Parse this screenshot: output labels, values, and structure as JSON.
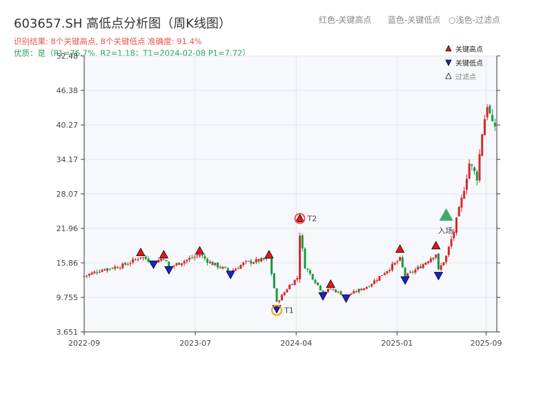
{
  "header": {
    "title": "603657.SH 高低点分析图（周K线图）",
    "hint_red": "红色-关键高点",
    "hint_blue": "蓝色-关键低点",
    "hint_filtered": "浅色-过滤点",
    "result_line": "识别结果: 8个关键高点, 8个关键低点  准确度: 91.4%",
    "quality_line": "优质：是（P1=76.7%, R2=1.18；T1=2024-02-08 P1=7.72）"
  },
  "legend": {
    "high": "关键高点",
    "low": "关键低点",
    "filtered": "过滤点"
  },
  "colors": {
    "up": "#d62728",
    "down": "#1a9641",
    "high_marker": "#e31a1c",
    "low_marker": "#1f1fd6",
    "t1": "#f0a500",
    "t2": "#e8554e",
    "entry": "#2ca05a",
    "result_text": "#e8554e",
    "quality_text": "#2ca05a"
  },
  "chart_data": {
    "type": "candlestick",
    "y_ticks": [
      "3.651",
      "9.755",
      "15.86",
      "21.96",
      "28.07",
      "34.17",
      "40.27",
      "46.38",
      "52.48"
    ],
    "ylim": [
      3.651,
      52.48
    ],
    "x_ticks": [
      "2022-09",
      "2023-07",
      "2024-04",
      "2025-01",
      "2025-09"
    ],
    "x_start": "2022-09-01",
    "x_end": "2025-09-30",
    "annotations": {
      "t1": {
        "label": "T1",
        "date": "2024-02-08",
        "value": 7.72
      },
      "t2": {
        "label": "T2",
        "date": "2024-04-11",
        "value": 23.6
      },
      "entry": {
        "label": "入场",
        "date": "2025-05-15",
        "value": 24.3
      }
    },
    "key_highs": [
      {
        "date": "2023-02-02",
        "value": 17.6
      },
      {
        "date": "2023-04-06",
        "value": 17.2
      },
      {
        "date": "2023-07-13",
        "value": 17.9
      },
      {
        "date": "2024-01-18",
        "value": 17.2
      },
      {
        "date": "2024-04-11",
        "value": 23.6
      },
      {
        "date": "2024-07-04",
        "value": 12.0
      },
      {
        "date": "2025-01-09",
        "value": 18.2
      },
      {
        "date": "2025-04-17",
        "value": 18.8
      }
    ],
    "key_lows": [
      {
        "date": "2023-03-09",
        "value": 15.6
      },
      {
        "date": "2023-04-20",
        "value": 14.6
      },
      {
        "date": "2023-10-05",
        "value": 13.8
      },
      {
        "date": "2024-02-08",
        "value": 7.72
      },
      {
        "date": "2024-06-13",
        "value": 10.0
      },
      {
        "date": "2024-08-15",
        "value": 9.6
      },
      {
        "date": "2025-01-23",
        "value": 12.8
      },
      {
        "date": "2025-04-24",
        "value": 13.6
      }
    ],
    "close_path": [
      [
        "2022-09-01",
        13.5
      ],
      [
        "2022-10-15",
        14.6
      ],
      [
        "2022-12-15",
        15.4
      ],
      [
        "2023-01-15",
        16.3
      ],
      [
        "2023-02-02",
        17.0
      ],
      [
        "2023-03-09",
        15.9
      ],
      [
        "2023-04-06",
        16.8
      ],
      [
        "2023-04-20",
        15.0
      ],
      [
        "2023-05-20",
        15.9
      ],
      [
        "2023-07-13",
        17.3
      ],
      [
        "2023-08-10",
        15.9
      ],
      [
        "2023-10-05",
        14.3
      ],
      [
        "2023-11-10",
        15.8
      ],
      [
        "2024-01-18",
        16.6
      ],
      [
        "2024-02-08",
        8.8
      ],
      [
        "2024-03-15",
        12.0
      ],
      [
        "2024-04-04",
        13.2
      ],
      [
        "2024-04-11",
        21.0
      ],
      [
        "2024-04-25",
        15.2
      ],
      [
        "2024-06-13",
        10.6
      ],
      [
        "2024-07-04",
        11.3
      ],
      [
        "2024-08-15",
        10.0
      ],
      [
        "2024-10-15",
        11.8
      ],
      [
        "2025-01-09",
        16.5
      ],
      [
        "2025-01-23",
        13.4
      ],
      [
        "2025-03-01",
        15.0
      ],
      [
        "2025-04-17",
        17.5
      ],
      [
        "2025-04-24",
        14.5
      ],
      [
        "2025-05-15",
        17.0
      ],
      [
        "2025-06-05",
        21.5
      ],
      [
        "2025-06-26",
        27.0
      ],
      [
        "2025-07-17",
        33.5
      ],
      [
        "2025-08-07",
        31.0
      ],
      [
        "2025-08-21",
        39.0
      ],
      [
        "2025-09-04",
        44.0
      ],
      [
        "2025-09-18",
        40.0
      ],
      [
        "2025-09-30",
        40.3
      ]
    ]
  }
}
